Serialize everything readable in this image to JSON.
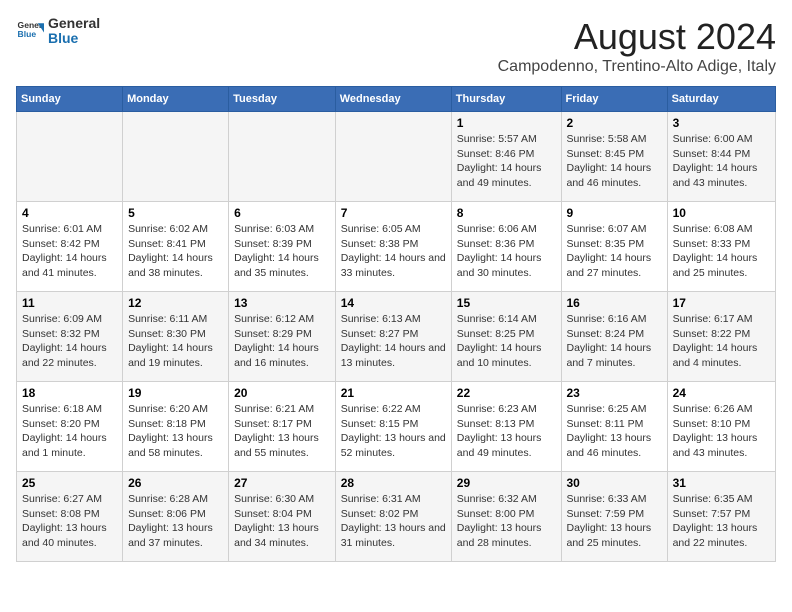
{
  "header": {
    "logo_general": "General",
    "logo_blue": "Blue",
    "main_title": "August 2024",
    "subtitle": "Campodenno, Trentino-Alto Adige, Italy"
  },
  "days_of_week": [
    "Sunday",
    "Monday",
    "Tuesday",
    "Wednesday",
    "Thursday",
    "Friday",
    "Saturday"
  ],
  "weeks": [
    {
      "cells": [
        {
          "empty": true
        },
        {
          "empty": true
        },
        {
          "empty": true
        },
        {
          "empty": true
        },
        {
          "day": 1,
          "sunrise": "5:57 AM",
          "sunset": "8:46 PM",
          "daylight": "14 hours and 49 minutes."
        },
        {
          "day": 2,
          "sunrise": "5:58 AM",
          "sunset": "8:45 PM",
          "daylight": "14 hours and 46 minutes."
        },
        {
          "day": 3,
          "sunrise": "6:00 AM",
          "sunset": "8:44 PM",
          "daylight": "14 hours and 43 minutes."
        }
      ]
    },
    {
      "cells": [
        {
          "day": 4,
          "sunrise": "6:01 AM",
          "sunset": "8:42 PM",
          "daylight": "14 hours and 41 minutes."
        },
        {
          "day": 5,
          "sunrise": "6:02 AM",
          "sunset": "8:41 PM",
          "daylight": "14 hours and 38 minutes."
        },
        {
          "day": 6,
          "sunrise": "6:03 AM",
          "sunset": "8:39 PM",
          "daylight": "14 hours and 35 minutes."
        },
        {
          "day": 7,
          "sunrise": "6:05 AM",
          "sunset": "8:38 PM",
          "daylight": "14 hours and 33 minutes."
        },
        {
          "day": 8,
          "sunrise": "6:06 AM",
          "sunset": "8:36 PM",
          "daylight": "14 hours and 30 minutes."
        },
        {
          "day": 9,
          "sunrise": "6:07 AM",
          "sunset": "8:35 PM",
          "daylight": "14 hours and 27 minutes."
        },
        {
          "day": 10,
          "sunrise": "6:08 AM",
          "sunset": "8:33 PM",
          "daylight": "14 hours and 25 minutes."
        }
      ]
    },
    {
      "cells": [
        {
          "day": 11,
          "sunrise": "6:09 AM",
          "sunset": "8:32 PM",
          "daylight": "14 hours and 22 minutes."
        },
        {
          "day": 12,
          "sunrise": "6:11 AM",
          "sunset": "8:30 PM",
          "daylight": "14 hours and 19 minutes."
        },
        {
          "day": 13,
          "sunrise": "6:12 AM",
          "sunset": "8:29 PM",
          "daylight": "14 hours and 16 minutes."
        },
        {
          "day": 14,
          "sunrise": "6:13 AM",
          "sunset": "8:27 PM",
          "daylight": "14 hours and 13 minutes."
        },
        {
          "day": 15,
          "sunrise": "6:14 AM",
          "sunset": "8:25 PM",
          "daylight": "14 hours and 10 minutes."
        },
        {
          "day": 16,
          "sunrise": "6:16 AM",
          "sunset": "8:24 PM",
          "daylight": "14 hours and 7 minutes."
        },
        {
          "day": 17,
          "sunrise": "6:17 AM",
          "sunset": "8:22 PM",
          "daylight": "14 hours and 4 minutes."
        }
      ]
    },
    {
      "cells": [
        {
          "day": 18,
          "sunrise": "6:18 AM",
          "sunset": "8:20 PM",
          "daylight": "14 hours and 1 minute."
        },
        {
          "day": 19,
          "sunrise": "6:20 AM",
          "sunset": "8:18 PM",
          "daylight": "13 hours and 58 minutes."
        },
        {
          "day": 20,
          "sunrise": "6:21 AM",
          "sunset": "8:17 PM",
          "daylight": "13 hours and 55 minutes."
        },
        {
          "day": 21,
          "sunrise": "6:22 AM",
          "sunset": "8:15 PM",
          "daylight": "13 hours and 52 minutes."
        },
        {
          "day": 22,
          "sunrise": "6:23 AM",
          "sunset": "8:13 PM",
          "daylight": "13 hours and 49 minutes."
        },
        {
          "day": 23,
          "sunrise": "6:25 AM",
          "sunset": "8:11 PM",
          "daylight": "13 hours and 46 minutes."
        },
        {
          "day": 24,
          "sunrise": "6:26 AM",
          "sunset": "8:10 PM",
          "daylight": "13 hours and 43 minutes."
        }
      ]
    },
    {
      "cells": [
        {
          "day": 25,
          "sunrise": "6:27 AM",
          "sunset": "8:08 PM",
          "daylight": "13 hours and 40 minutes."
        },
        {
          "day": 26,
          "sunrise": "6:28 AM",
          "sunset": "8:06 PM",
          "daylight": "13 hours and 37 minutes."
        },
        {
          "day": 27,
          "sunrise": "6:30 AM",
          "sunset": "8:04 PM",
          "daylight": "13 hours and 34 minutes."
        },
        {
          "day": 28,
          "sunrise": "6:31 AM",
          "sunset": "8:02 PM",
          "daylight": "13 hours and 31 minutes."
        },
        {
          "day": 29,
          "sunrise": "6:32 AM",
          "sunset": "8:00 PM",
          "daylight": "13 hours and 28 minutes."
        },
        {
          "day": 30,
          "sunrise": "6:33 AM",
          "sunset": "7:59 PM",
          "daylight": "13 hours and 25 minutes."
        },
        {
          "day": 31,
          "sunrise": "6:35 AM",
          "sunset": "7:57 PM",
          "daylight": "13 hours and 22 minutes."
        }
      ]
    }
  ]
}
